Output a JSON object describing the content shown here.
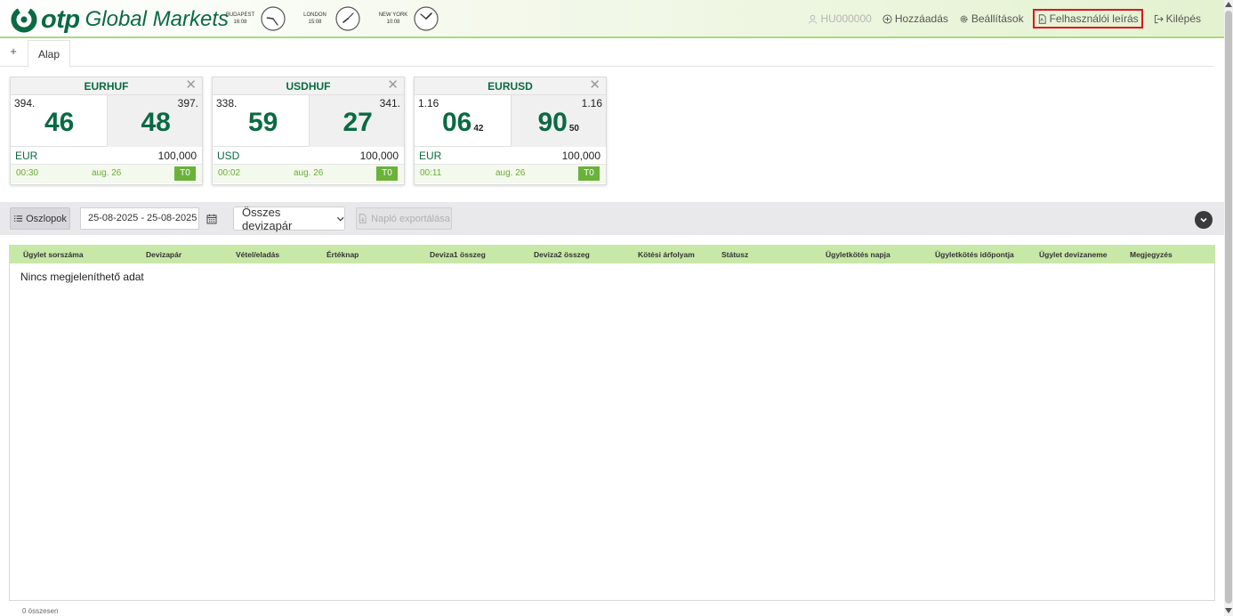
{
  "header": {
    "logo_otp": "otp",
    "logo_gm": "Global Markets",
    "clocks": [
      {
        "city": "BUDAPEST",
        "time": "16:08"
      },
      {
        "city": "LONDON",
        "time": "15:08"
      },
      {
        "city": "NEW YORK",
        "time": "10:08"
      }
    ],
    "nav": {
      "user": "HU000000",
      "add": "Hozzáadás",
      "settings": "Beállítások",
      "manual": "Felhasználói leírás",
      "logout": "Kilépés"
    },
    "brand_color": "#0a6a43",
    "highlight_color": "#e0141e"
  },
  "tabs": {
    "add": "+",
    "items": [
      {
        "label": "Alap"
      }
    ]
  },
  "tiles": [
    {
      "pair": "EURHUF",
      "close": "✕",
      "sell_small": "394.",
      "sell_big": "46",
      "sell_pip": "",
      "buy_small": "397.",
      "buy_big": "48",
      "buy_pip": "",
      "currency": "EUR",
      "amount": "100,000",
      "time": "00:30",
      "date": "aug. 26",
      "tenor": "T0"
    },
    {
      "pair": "USDHUF",
      "close": "✕",
      "sell_small": "338.",
      "sell_big": "59",
      "sell_pip": "",
      "buy_small": "341.",
      "buy_big": "27",
      "buy_pip": "",
      "currency": "USD",
      "amount": "100,000",
      "time": "00:02",
      "date": "aug. 26",
      "tenor": "T0"
    },
    {
      "pair": "EURUSD",
      "close": "✕",
      "sell_small": "1.16",
      "sell_big": "06",
      "sell_pip": "42",
      "buy_small": "1.16",
      "buy_big": "90",
      "buy_pip": "50",
      "currency": "EUR",
      "amount": "100,000",
      "time": "00:11",
      "date": "aug. 26",
      "tenor": "T0"
    }
  ],
  "toolbar": {
    "columns_label": "Oszlopok",
    "date_range": "25-08-2025 - 25-08-2025",
    "pair_select": "Összes devizapár",
    "export_label": "Napló exportálása"
  },
  "table": {
    "columns": [
      "Ügylet sorszáma",
      "Devizapár",
      "Vétel/eladás",
      "Értéknap",
      "Deviza1 összeg",
      "Deviza2 összeg",
      "Kötési árfolyam",
      "Státusz",
      "Ügyletkötés napja",
      "Ügyletkötés időpontja",
      "Ügylet devizaneme",
      "Megjegyzés"
    ],
    "empty_message": "Nincs megjeleníthető adat",
    "total_label": "0 összesen",
    "header_color": "#c8e8a8"
  }
}
